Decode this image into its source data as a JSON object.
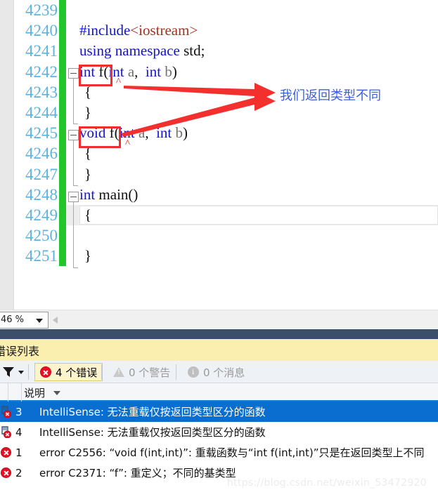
{
  "editor": {
    "zoom_level": "46 %",
    "lines": [
      {
        "number": "4239",
        "tokens": []
      },
      {
        "number": "4240",
        "tokens": [
          {
            "t": "#include",
            "c": "kw"
          },
          {
            "t": "<iostream>",
            "c": "str"
          }
        ]
      },
      {
        "number": "4241",
        "tokens": [
          {
            "t": "using namespace ",
            "c": "kw"
          },
          {
            "t": "std;",
            "c": "plain"
          }
        ]
      },
      {
        "number": "4242",
        "tokens": [
          {
            "t": "int",
            "c": "kw"
          },
          {
            "t": " f(",
            "c": "plain"
          },
          {
            "t": "int",
            "c": "kw"
          },
          {
            "t": " ",
            "c": "plain"
          },
          {
            "t": "a",
            "c": "gray"
          },
          {
            "t": ",  ",
            "c": "plain"
          },
          {
            "t": "int",
            "c": "kw"
          },
          {
            "t": " ",
            "c": "plain"
          },
          {
            "t": "b",
            "c": "gray"
          },
          {
            "t": ")",
            "c": "plain"
          }
        ]
      },
      {
        "number": "4243",
        "tokens": [
          {
            "t": "{",
            "c": "plain"
          }
        ]
      },
      {
        "number": "4244",
        "tokens": [
          {
            "t": "}",
            "c": "plain"
          }
        ]
      },
      {
        "number": "4245",
        "tokens": [
          {
            "t": "void",
            "c": "kw"
          },
          {
            "t": " f(",
            "c": "plain"
          },
          {
            "t": "int",
            "c": "kw"
          },
          {
            "t": " ",
            "c": "plain"
          },
          {
            "t": "a",
            "c": "gray"
          },
          {
            "t": ",  ",
            "c": "plain"
          },
          {
            "t": "int",
            "c": "kw"
          },
          {
            "t": " ",
            "c": "plain"
          },
          {
            "t": "b",
            "c": "gray"
          },
          {
            "t": ")",
            "c": "plain"
          }
        ]
      },
      {
        "number": "4246",
        "tokens": [
          {
            "t": "{",
            "c": "plain"
          }
        ]
      },
      {
        "number": "4247",
        "tokens": [
          {
            "t": "}",
            "c": "plain"
          }
        ]
      },
      {
        "number": "4248",
        "tokens": [
          {
            "t": "int",
            "c": "kw"
          },
          {
            "t": " main()",
            "c": "plain"
          }
        ]
      },
      {
        "number": "4249",
        "tokens": [
          {
            "t": "{",
            "c": "plain"
          }
        ]
      },
      {
        "number": "4250",
        "tokens": []
      },
      {
        "number": "4251",
        "tokens": [
          {
            "t": "}",
            "c": "plain"
          }
        ]
      }
    ],
    "annotation": "我们返回类型不同",
    "colors": {
      "changebar": "#22c52a",
      "linenumber": "#5bb3e0",
      "keyword": "#1414d0",
      "string": "#a33220",
      "redbox": "#f22d2d",
      "annotation": "#3b5fdb"
    }
  },
  "error_panel": {
    "title": "错误列表",
    "toolbar": {
      "filter_icon": "filter-funnel-icon",
      "errors_label": "4 个错误",
      "warnings_label": "0 个警告",
      "messages_label": "0 个消息"
    },
    "columns": [
      {
        "label": "说明"
      }
    ],
    "rows": [
      {
        "icon": "intellisense-error-icon",
        "num": "3",
        "desc": "IntelliSense: 无法重载仅按返回类型区分的函数",
        "selected": true
      },
      {
        "icon": "intellisense-error-icon",
        "num": "4",
        "desc": "IntelliSense: 无法重载仅按返回类型区分的函数",
        "selected": false
      },
      {
        "icon": "error-icon",
        "num": "1",
        "desc": "error C2556: “void f(int,int)”: 重载函数与“int f(int,int)”只是在返回类型上不同",
        "selected": false
      },
      {
        "icon": "error-icon",
        "num": "2",
        "desc": "error C2371: “f”: 重定义；不同的基类型",
        "selected": false
      }
    ]
  },
  "watermark": "https://blog.csdn.net/weixin_53472920"
}
